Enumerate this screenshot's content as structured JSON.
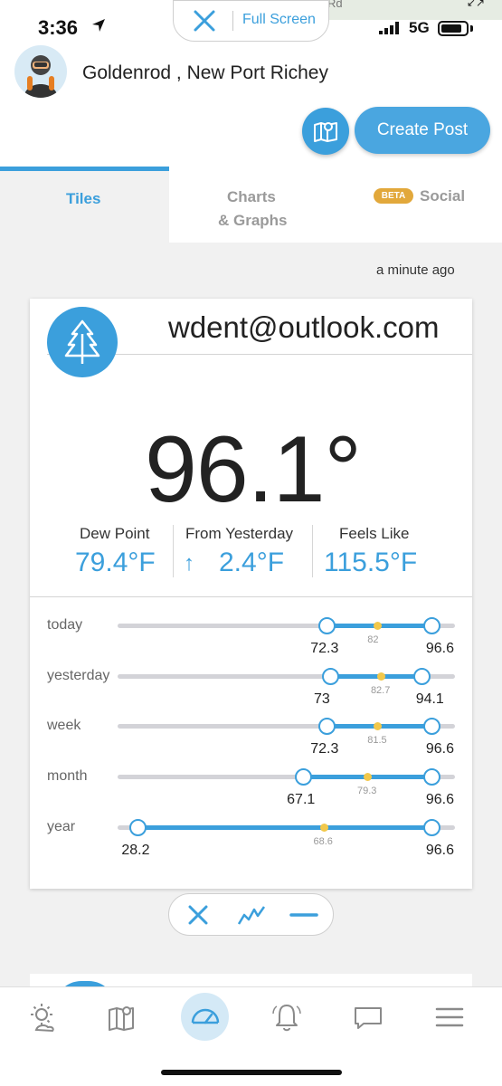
{
  "status_bar": {
    "time": "3:36",
    "network": "5G"
  },
  "map_peek": {
    "road_label": "Rd"
  },
  "fullscreen_pill": {
    "label": "Full Screen"
  },
  "header": {
    "location": "Goldenrod , New Port Richey",
    "create_post": "Create Post"
  },
  "tabs": [
    {
      "label": "Tiles",
      "active": true
    },
    {
      "label_line1": "Charts",
      "label_line2": "& Graphs",
      "active": false
    },
    {
      "badge": "BETA",
      "label": "Social",
      "active": false
    }
  ],
  "updated": "a minute ago",
  "tile": {
    "station": "wdent@outlook.com",
    "temperature": "96.1°",
    "metrics": [
      {
        "label": "Dew Point",
        "value": "79.4°F"
      },
      {
        "label": "From Yesterday",
        "value": "2.4°F",
        "direction": "↑"
      },
      {
        "label": "Feels Like",
        "value": "115.5°F"
      }
    ],
    "ranges": [
      {
        "label": "today",
        "low": "72.3",
        "high": "96.6",
        "avg": "82",
        "low_f": 0.62,
        "high_f": 0.93,
        "avg_f": 0.77
      },
      {
        "label": "yesterday",
        "low": "73",
        "high": "94.1",
        "avg": "82.7",
        "low_f": 0.63,
        "high_f": 0.9,
        "avg_f": 0.78
      },
      {
        "label": "week",
        "low": "72.3",
        "high": "96.6",
        "avg": "81.5",
        "low_f": 0.62,
        "high_f": 0.93,
        "avg_f": 0.77
      },
      {
        "label": "month",
        "low": "67.1",
        "high": "96.6",
        "avg": "79.3",
        "low_f": 0.55,
        "high_f": 0.93,
        "avg_f": 0.74
      },
      {
        "label": "year",
        "low": "28.2",
        "high": "96.6",
        "avg": "68.6",
        "low_f": 0.06,
        "high_f": 0.93,
        "avg_f": 0.61
      }
    ]
  },
  "colors": {
    "accent": "#3b9fdc",
    "avg_dot": "#f2c84b",
    "beta_badge": "#e2a83b"
  },
  "icons": {
    "tile_icon": "tree-icon",
    "nav": [
      "weather-sun-icon",
      "map-icon",
      "gauge-icon",
      "bell-icon",
      "chat-icon",
      "menu-icon"
    ],
    "tile_controls": [
      "close-icon",
      "line-chart-icon",
      "minus-icon"
    ]
  }
}
